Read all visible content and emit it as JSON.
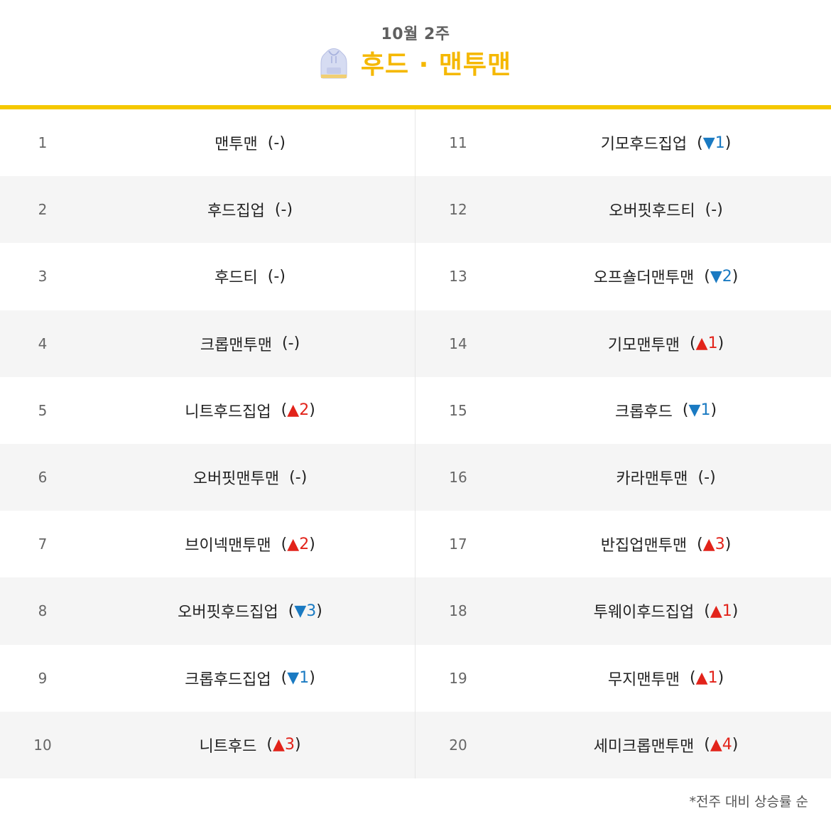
{
  "header": {
    "period": "10월 2주",
    "title": "후드 · 맨투맨",
    "icon": "hoodie-icon"
  },
  "colors": {
    "accent": "#f5c800",
    "title": "#f5b800",
    "up": "#e2231a",
    "down": "#1a7ac2"
  },
  "rankings": [
    {
      "rank": "1",
      "name": "맨투맨",
      "dir": "same",
      "delta": "-"
    },
    {
      "rank": "2",
      "name": "후드집업",
      "dir": "same",
      "delta": "-"
    },
    {
      "rank": "3",
      "name": "후드티",
      "dir": "same",
      "delta": "-"
    },
    {
      "rank": "4",
      "name": "크롭맨투맨",
      "dir": "same",
      "delta": "-"
    },
    {
      "rank": "5",
      "name": "니트후드집업",
      "dir": "up",
      "delta": "2"
    },
    {
      "rank": "6",
      "name": "오버핏맨투맨",
      "dir": "same",
      "delta": "-"
    },
    {
      "rank": "7",
      "name": "브이넥맨투맨",
      "dir": "up",
      "delta": "2"
    },
    {
      "rank": "8",
      "name": "오버핏후드집업",
      "dir": "down",
      "delta": "3"
    },
    {
      "rank": "9",
      "name": "크롭후드집업",
      "dir": "down",
      "delta": "1"
    },
    {
      "rank": "10",
      "name": "니트후드",
      "dir": "up",
      "delta": "3"
    },
    {
      "rank": "11",
      "name": "기모후드집업",
      "dir": "down",
      "delta": "1"
    },
    {
      "rank": "12",
      "name": "오버핏후드티",
      "dir": "same",
      "delta": "-"
    },
    {
      "rank": "13",
      "name": "오프숄더맨투맨",
      "dir": "down",
      "delta": "2"
    },
    {
      "rank": "14",
      "name": "기모맨투맨",
      "dir": "up",
      "delta": "1"
    },
    {
      "rank": "15",
      "name": "크롭후드",
      "dir": "down",
      "delta": "1"
    },
    {
      "rank": "16",
      "name": "카라맨투맨",
      "dir": "same",
      "delta": "-"
    },
    {
      "rank": "17",
      "name": "반집업맨투맨",
      "dir": "up",
      "delta": "3"
    },
    {
      "rank": "18",
      "name": "투웨이후드집업",
      "dir": "up",
      "delta": "1"
    },
    {
      "rank": "19",
      "name": "무지맨투맨",
      "dir": "up",
      "delta": "1"
    },
    {
      "rank": "20",
      "name": "세미크롭맨투맨",
      "dir": "up",
      "delta": "4"
    }
  ],
  "footnote": "*전주 대비 상승률 순"
}
